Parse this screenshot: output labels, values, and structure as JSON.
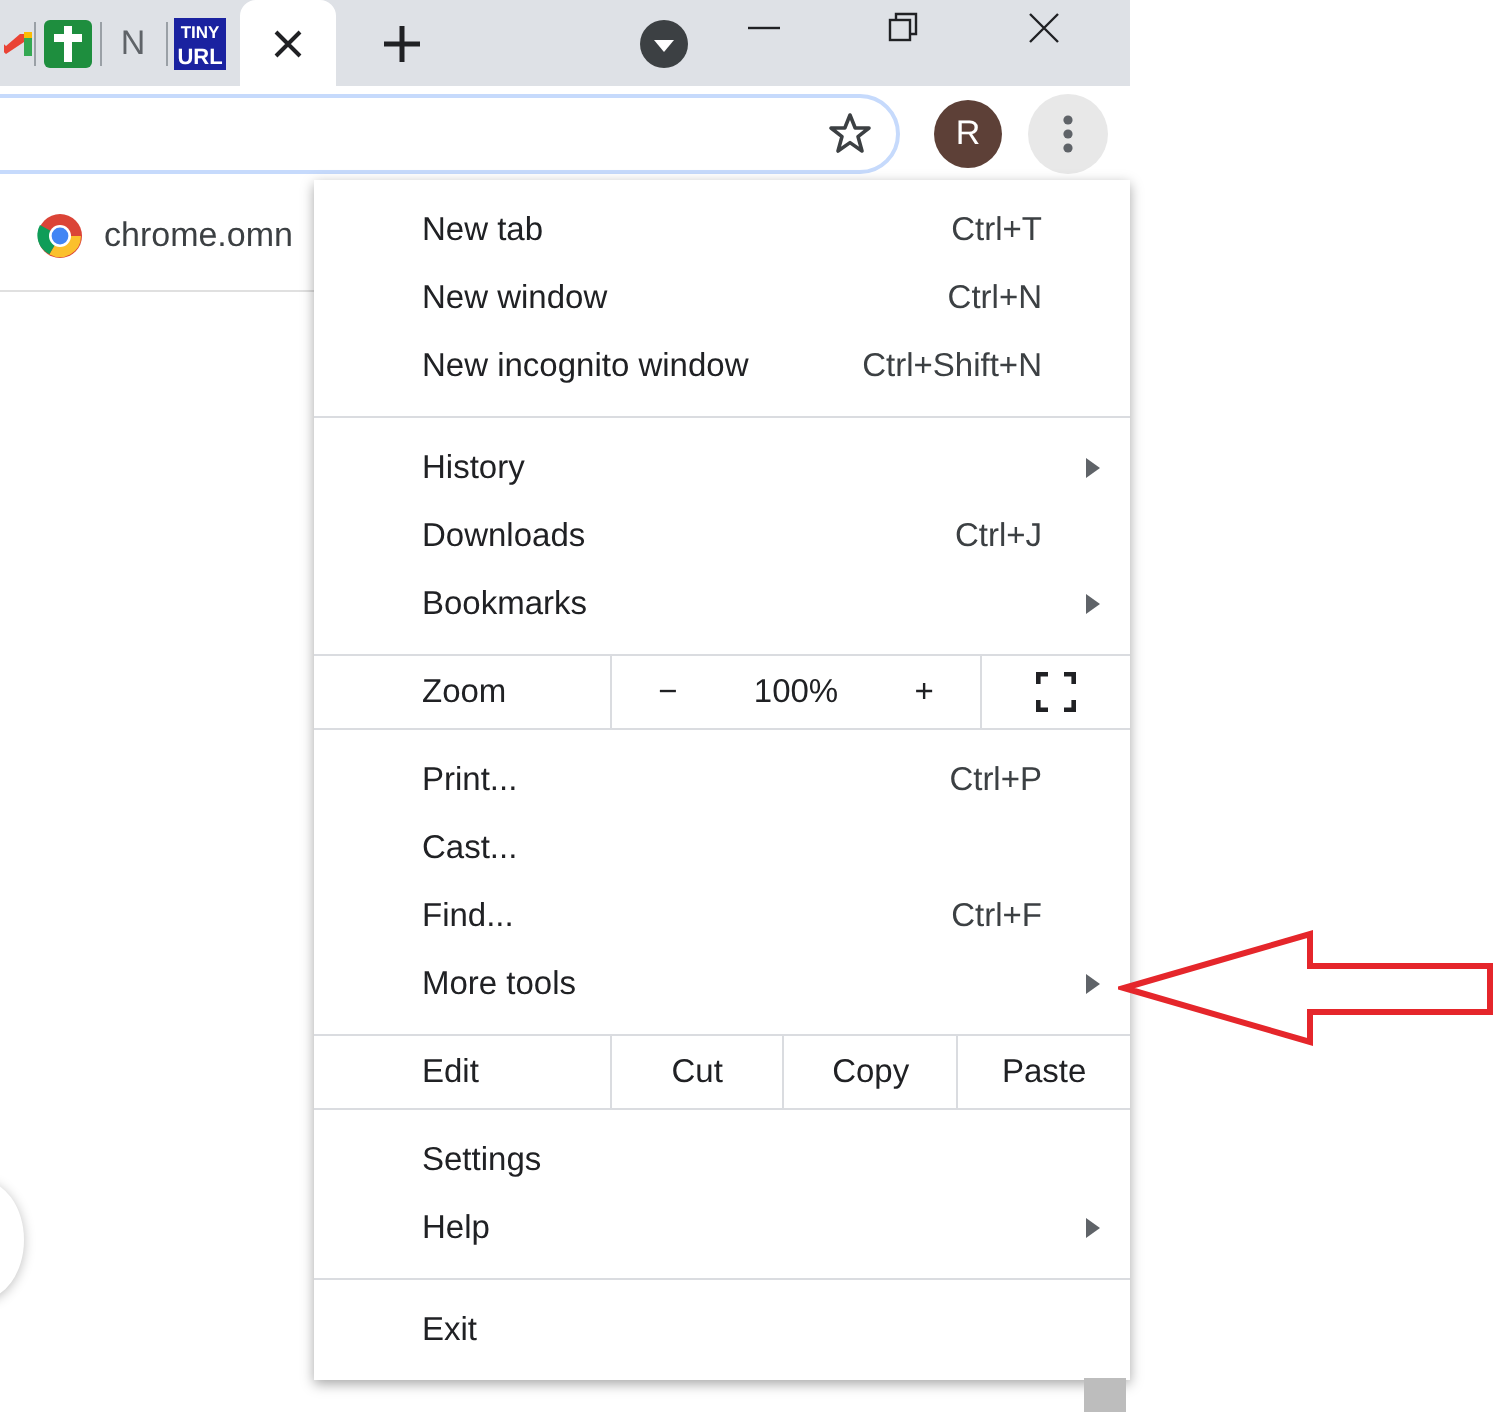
{
  "tabs": [
    {
      "kind": "mail",
      "selected": false
    },
    {
      "kind": "cross",
      "selected": false
    },
    {
      "kind": "letter",
      "label": "N",
      "selected": false
    },
    {
      "kind": "tinyurl",
      "label": "TINY",
      "label_2": "URL",
      "selected": false
    },
    {
      "selected": true
    }
  ],
  "toolbar": {
    "bookmarked": false,
    "avatar_letter": "R"
  },
  "suggestion": {
    "text": "chrome.omn"
  },
  "menu": {
    "groups": [
      {
        "kind": "items",
        "items": [
          {
            "label": "New tab",
            "shortcut": "Ctrl+T",
            "submenu": false
          },
          {
            "label": "New window",
            "shortcut": "Ctrl+N",
            "submenu": false
          },
          {
            "label": "New incognito window",
            "shortcut": "Ctrl+Shift+N",
            "submenu": false
          }
        ]
      },
      {
        "kind": "items",
        "items": [
          {
            "label": "History",
            "submenu": true
          },
          {
            "label": "Downloads",
            "shortcut": "Ctrl+J",
            "submenu": false
          },
          {
            "label": "Bookmarks",
            "submenu": true
          }
        ]
      },
      {
        "kind": "zoom",
        "label": "Zoom",
        "minus": "−",
        "value": "100%",
        "plus": "+"
      },
      {
        "kind": "items",
        "items": [
          {
            "label": "Print...",
            "shortcut": "Ctrl+P",
            "submenu": false
          },
          {
            "label": "Cast...",
            "submenu": false
          },
          {
            "label": "Find...",
            "shortcut": "Ctrl+F",
            "submenu": false
          },
          {
            "label": "More tools",
            "submenu": true
          }
        ]
      },
      {
        "kind": "edit",
        "label": "Edit",
        "buttons": [
          "Cut",
          "Copy",
          "Paste"
        ]
      },
      {
        "kind": "items",
        "items": [
          {
            "label": "Settings",
            "submenu": false
          },
          {
            "label": "Help",
            "submenu": true
          }
        ]
      },
      {
        "kind": "items",
        "items": [
          {
            "label": "Exit",
            "submenu": false
          }
        ]
      }
    ]
  }
}
